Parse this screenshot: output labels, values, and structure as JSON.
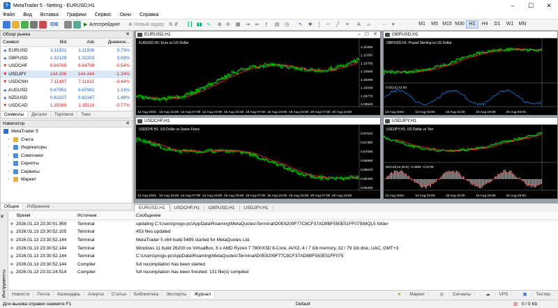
{
  "window": {
    "title": "MetaTrader 5 - Netting - EURUSD,H1"
  },
  "menu": [
    "Файл",
    "Вид",
    "Вставка",
    "Графики",
    "Сервис",
    "Окно",
    "Справка"
  ],
  "toolbar": {
    "ide": "IDE",
    "algo": "Алготрейдинг",
    "new_order": "Новый ордер",
    "timeframes": [
      "M1",
      "M5",
      "M15",
      "M30",
      "H1",
      "H4",
      "D1",
      "W1",
      "MN"
    ],
    "active_tf": "H1"
  },
  "market_watch": {
    "title": "Обзор рынка",
    "columns": [
      "Символ",
      "Bid",
      "Ask",
      "Дневное..."
    ],
    "rows": [
      {
        "symbol": "EURUSD",
        "bid": "1.11921",
        "ask": "1.11936",
        "change": "0.73%",
        "dir": "up"
      },
      {
        "symbol": "GBPUSD",
        "bid": "1.32129",
        "ask": "1.32203",
        "change": "0.93%",
        "dir": "up"
      },
      {
        "symbol": "USDCHF",
        "bid": "0.84760",
        "ask": "0.84799",
        "change": "-0.54%",
        "dir": "dn"
      },
      {
        "symbol": "USDJPY",
        "bid": "144.336",
        "ask": "144.444",
        "change": "-1.34%",
        "dir": "dn"
      },
      {
        "symbol": "USDCNH",
        "bid": "7.11487",
        "ask": "7.11831",
        "change": "-0.44%",
        "dir": "dn"
      },
      {
        "symbol": "AUDUSD",
        "bid": "0.67951",
        "ask": "0.67982",
        "change": "1.33%",
        "dir": "up"
      },
      {
        "symbol": "NZDUSD",
        "bid": "0.62327",
        "ask": "0.62347",
        "change": "1.49%",
        "dir": "up"
      },
      {
        "symbol": "USDCAD",
        "bid": "1.35080",
        "ask": "1.35110",
        "change": "-0.77%",
        "dir": "dn"
      }
    ],
    "tabs": [
      "Символы",
      "Детали",
      "Торговля",
      "Тики"
    ]
  },
  "navigator": {
    "title": "Навигатор",
    "root": "MetaTrader 5",
    "items": [
      "Счета",
      "Индикаторы",
      "Советники",
      "Скрипты",
      "Сервисы",
      "Маркет"
    ],
    "tabs": [
      "Общие",
      "Избранное"
    ]
  },
  "charts": [
    {
      "id": "eurusd",
      "title": "EURUSD,H1",
      "label": "EURUSD,H1: Euro vs US Dollar",
      "prices": [
        "1.11305",
        "1.11050",
        "1.10795",
        "1.10540",
        "1.10285",
        "1.10030",
        "1.09775",
        "1.09520"
      ],
      "dates": [
        "12 Aug 2024",
        "13 Aug 15:00",
        "14 Aug 07:00",
        "14 Aug 23:00",
        "15 Aug 15:00",
        "16 Aug 07:00",
        "16 Aug 23:00",
        "19 Aug 15:00",
        "20 Aug 07:00",
        "20 Aug 23:00"
      ]
    },
    {
      "id": "gbpusd",
      "title": "GBPUSD,H1",
      "label": "GBPUSD,H1: Pound Sterling vs US Dollar",
      "indicator": "CCI(14) 12.83",
      "dates": [
        "12 Aug 2024",
        "14 Aug 03:00",
        "15 Aug 11:00",
        "16 Aug 19:00",
        "20 Aug 03:00"
      ]
    },
    {
      "id": "usdchf",
      "title": "USDCHF,H1",
      "label": "USDCHF,H1: US Dollar vs Swiss Franc",
      "prices": [
        "0.87510",
        "0.87300",
        "0.87090",
        "0.86880",
        "0.86670",
        "0.86460",
        "0.86250"
      ],
      "dates": [
        "12 Aug 2024",
        "13 Aug 15:00",
        "14 Aug 07:00",
        "14 Aug 23:00",
        "15 Aug 15:00",
        "16 Aug 07:00",
        "16 Aug 23:00",
        "19 Aug 15:00",
        "20 Aug 07:00",
        "20 Aug 23:00"
      ]
    },
    {
      "id": "usdjpy",
      "title": "USDJPY,H1",
      "label": "USDJPY,H1: US Dollar vs Yen",
      "indicator": "MACD(12,26,9) -0.3582 -0.3739",
      "dates": [
        "12 Aug 2024",
        "14 Aug 03:00",
        "15 Aug 11:00",
        "16 Aug 19:00",
        "20 Aug 03:00"
      ]
    }
  ],
  "chart_tabs": [
    "EURUSD,H1",
    "USDCHF,H1",
    "GBPUSD,H1",
    "USDJPY,H1"
  ],
  "journal": {
    "columns": [
      "Время",
      "Источник",
      "Сообщение"
    ],
    "rows": [
      {
        "time": "2026.01.13 23:30:51.959",
        "source": "Terminal",
        "msg": "updating C:\\Users\\progs-pc\\AppData\\Roaming\\MetaQuotes\\Terminal\\D0E8209F77C8CF37AD8BF550E51FF075\\MQL5 folder"
      },
      {
        "time": "2026.01.13 23:30:52.105",
        "source": "Terminal",
        "msg": "453 files updated"
      },
      {
        "time": "2026.01.13 23:30:52.144",
        "source": "Terminal",
        "msg": "MetaTrader 5 x64 build 5495 started for MetaQuotes Ltd."
      },
      {
        "time": "2026.01.13 23:30:52.144",
        "source": "Terminal",
        "msg": "Windows 11 build 26200 on VirtualBox, 6 x AMD Ryzen 7 7800X3D 8-Core, AVX2, 4 / 7 Gb memory, 32 / 79 Gb disk, UAC, GMT+3"
      },
      {
        "time": "2026.01.13 23:30:52.144",
        "source": "Terminal",
        "msg": "C:\\Users\\progs-pc\\AppData\\Roaming\\MetaQuotes\\Terminal\\D0E8209F77C8CF37AD8BF550E51FF075"
      },
      {
        "time": "2026.01.13 23:30:52.144",
        "source": "Compiler",
        "msg": "full recompilation has been started"
      },
      {
        "time": "2026.01.13 23:31:24.514",
        "source": "Compiler",
        "msg": "full recompilation has been finished: 131 file(s) compiled"
      }
    ],
    "side_label": "Инструменты",
    "tabs": [
      "Новости",
      "Почта",
      "Календарь",
      "Алерты",
      "Статьи",
      "Библиотека",
      "Эксперты",
      "Журнал"
    ],
    "active_tab": "Журнал",
    "right_buttons": [
      "Маркет",
      "Сигналы",
      "VPS",
      "Тестер"
    ]
  },
  "status": {
    "help": "Для вызова справки нажмите F1",
    "profile": "Default",
    "traffic": "0 / 0 Kb"
  },
  "colors": {
    "up_bar": "#00ff00",
    "down_bar": "#00c000",
    "ma": "#ff3030",
    "bg": "#000000",
    "grid": "#202020"
  }
}
